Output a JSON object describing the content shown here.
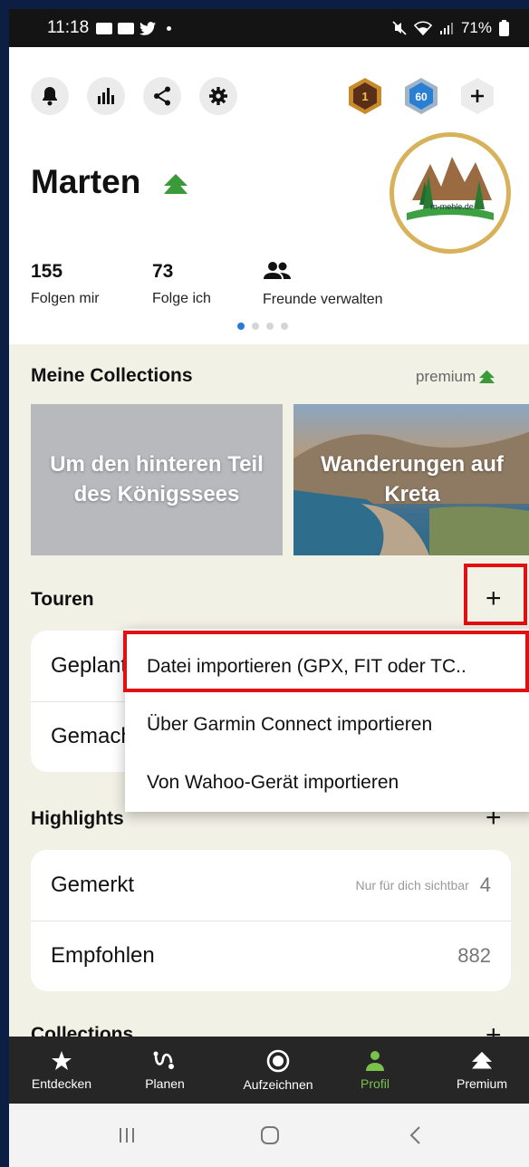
{
  "status_bar": {
    "time": "11:18",
    "battery": "71%"
  },
  "profile": {
    "name": "Marten",
    "badges": {
      "level": "1",
      "points": "60"
    },
    "stats": [
      {
        "num": "155",
        "label": "Folgen mir"
      },
      {
        "num": "73",
        "label": "Folge ich"
      }
    ],
    "friends_label": "Freunde verwalten",
    "avatar_text": "m-mehle.de",
    "pager_active": 1
  },
  "collections": {
    "title": "Meine Collections",
    "premium": "premium",
    "cards": [
      "Um den hinteren Teil des Königssees",
      "Wanderungen auf Kreta"
    ]
  },
  "touren": {
    "title": "Touren",
    "plus": "+",
    "rows": [
      "Geplant",
      "Gemacht"
    ]
  },
  "menu": {
    "items": [
      "Datei importieren (GPX, FIT oder TC..",
      "Über Garmin Connect importieren",
      "Von Wahoo-Gerät importieren"
    ]
  },
  "highlights": {
    "title": "Highlights",
    "plus": "+",
    "rows": [
      {
        "label": "Gemerkt",
        "hint": "Nur für dich sichtbar",
        "count": "4"
      },
      {
        "label": "Empfohlen",
        "hint": "",
        "count": "882"
      }
    ]
  },
  "collections_section": {
    "title": "Collections",
    "plus": "+"
  },
  "bottom_nav": [
    {
      "label": "Entdecken",
      "icon": "star-icon"
    },
    {
      "label": "Planen",
      "icon": "route-icon"
    },
    {
      "label": "Aufzeichnen",
      "icon": "record-icon"
    },
    {
      "label": "Profil",
      "icon": "person-icon"
    },
    {
      "label": "Premium",
      "icon": "premium-tree-icon"
    }
  ],
  "colors": {
    "accent_green": "#79c34a",
    "highlight_red": "#e31013",
    "pager_blue": "#2a79d8",
    "background": "#f2f1e6"
  }
}
